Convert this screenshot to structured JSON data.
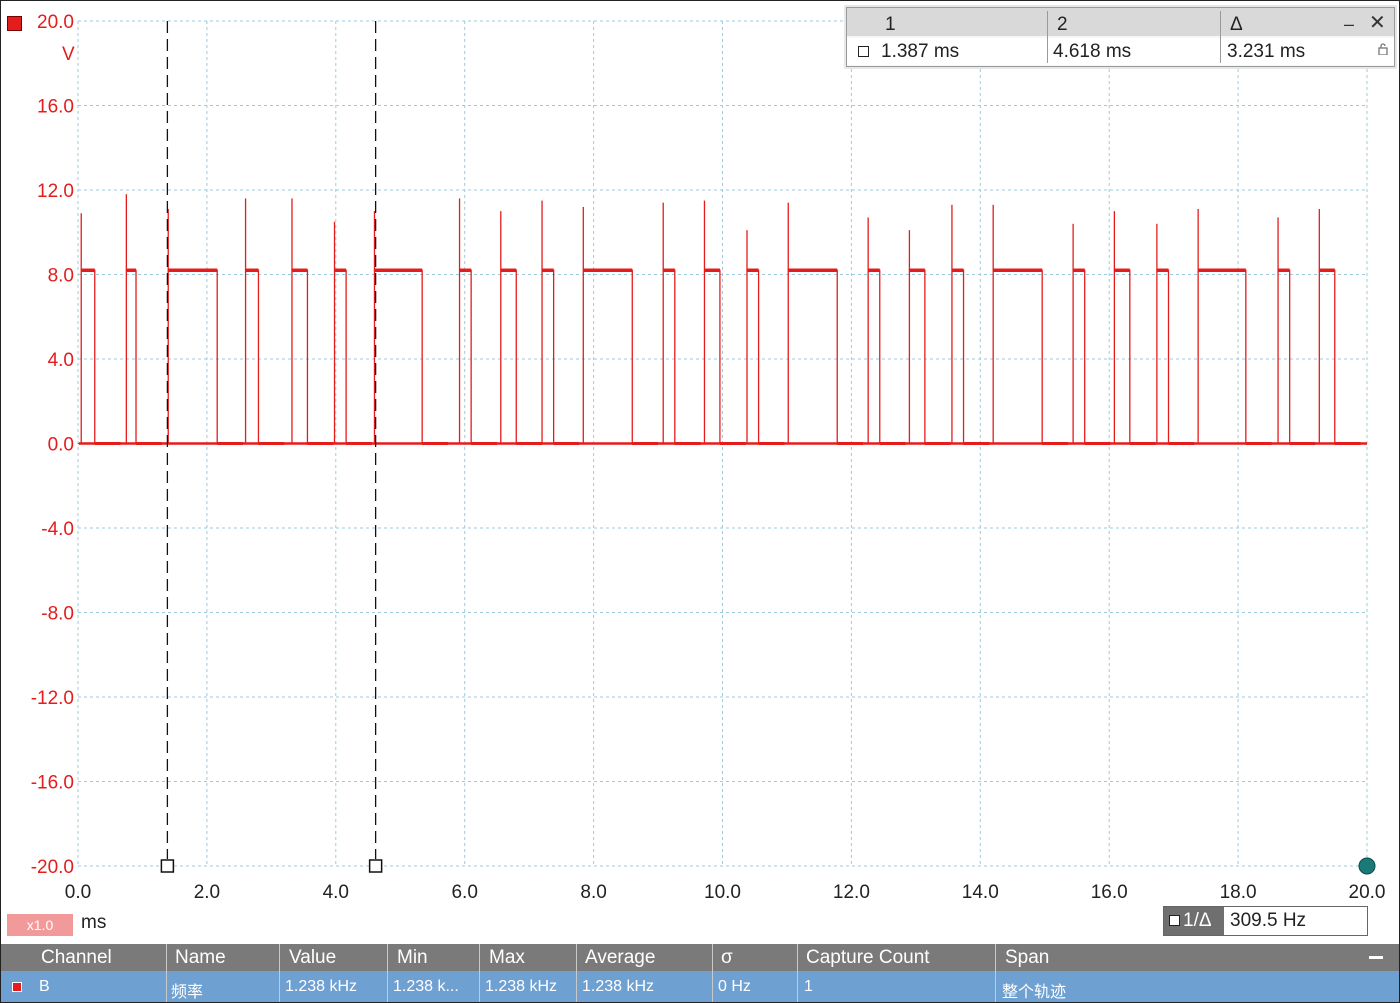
{
  "chart_data": {
    "type": "line",
    "xlabel": "ms",
    "ylabel": "V",
    "xlim": [
      0,
      20
    ],
    "ylim": [
      -20,
      20
    ],
    "x_ticks": [
      "0.0",
      "2.0",
      "4.0",
      "6.0",
      "8.0",
      "10.0",
      "12.0",
      "14.0",
      "16.0",
      "18.0",
      "20.0"
    ],
    "y_ticks": [
      "20.0",
      "16.0",
      "12.0",
      "8.0",
      "4.0",
      "0.0",
      "-4.0",
      "-8.0",
      "-12.0",
      "-16.0",
      "-20.0"
    ],
    "grid": true,
    "series": [
      {
        "name": "B",
        "color": "#e51c1c",
        "high_level": 8.2,
        "low_level": 0.0,
        "pulses": [
          [
            0.05,
            0.26
          ],
          [
            0.75,
            0.9
          ],
          [
            1.4,
            2.16
          ],
          [
            2.6,
            2.8
          ],
          [
            3.32,
            3.56
          ],
          [
            3.98,
            4.16
          ],
          [
            4.6,
            5.34
          ],
          [
            5.92,
            6.1
          ],
          [
            6.56,
            6.8
          ],
          [
            7.2,
            7.38
          ],
          [
            7.84,
            8.6
          ],
          [
            9.08,
            9.26
          ],
          [
            9.72,
            9.96
          ],
          [
            10.38,
            10.56
          ],
          [
            11.02,
            11.78
          ],
          [
            12.26,
            12.44
          ],
          [
            12.9,
            13.14
          ],
          [
            13.56,
            13.74
          ],
          [
            14.2,
            14.96
          ],
          [
            15.44,
            15.62
          ],
          [
            16.08,
            16.32
          ],
          [
            16.74,
            16.92
          ],
          [
            17.38,
            18.12
          ],
          [
            18.62,
            18.8
          ],
          [
            19.26,
            19.5
          ]
        ],
        "spikes": [
          [
            0.05,
            10.9
          ],
          [
            0.75,
            11.8
          ],
          [
            1.4,
            11.1
          ],
          [
            2.6,
            11.6
          ],
          [
            3.32,
            11.6
          ],
          [
            3.98,
            10.5
          ],
          [
            4.6,
            11.0
          ],
          [
            5.92,
            11.6
          ],
          [
            6.56,
            11.0
          ],
          [
            7.2,
            11.5
          ],
          [
            7.84,
            11.2
          ],
          [
            9.08,
            11.4
          ],
          [
            9.72,
            11.5
          ],
          [
            10.38,
            10.1
          ],
          [
            11.02,
            11.4
          ],
          [
            12.26,
            10.7
          ],
          [
            12.9,
            10.1
          ],
          [
            13.56,
            11.3
          ],
          [
            14.2,
            11.3
          ],
          [
            15.44,
            10.4
          ],
          [
            16.08,
            11.0
          ],
          [
            16.74,
            10.4
          ],
          [
            17.38,
            11.1
          ],
          [
            18.62,
            10.7
          ],
          [
            19.26,
            11.1
          ]
        ]
      }
    ],
    "y_axis_top_label": "20.0",
    "y_unit": "V"
  },
  "cursors": {
    "marker_colors": {
      "line": "#111111",
      "handle": "#ffffff"
    },
    "cursor1_ms": 1.387,
    "cursor2_ms": 4.618,
    "header": {
      "c1": "1",
      "c2": "2",
      "delta": "Δ",
      "minimize": "–",
      "close": "✕"
    },
    "values": {
      "c1": "1.387 ms",
      "c2": "4.618 ms",
      "delta": "3.231 ms"
    }
  },
  "trigger_marker_color": "#1a7a7a",
  "scale_badge": "x1.0",
  "x_unit": "ms",
  "freq_box": {
    "label": "1/Δ",
    "value": "309.5 Hz"
  },
  "measurements": {
    "headers": [
      "Channel",
      "Name",
      "Value",
      "Min",
      "Max",
      "Average",
      "σ",
      "Capture Count",
      "Span"
    ],
    "row": [
      "B",
      "频率",
      "1.238 kHz",
      "1.238 k...",
      "1.238 kHz",
      "1.238 kHz",
      "0 Hz",
      "1",
      "整个轨迹"
    ]
  }
}
